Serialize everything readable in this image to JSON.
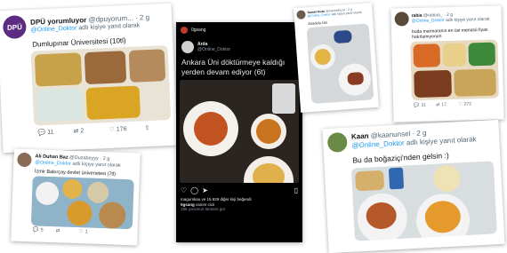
{
  "tweet_dpu": {
    "name": "DPÜ yorumluyor",
    "handle_time": "@dpuyorum... · 2 g",
    "reply_prefix": "@Online_Doktor",
    "reply_suffix": "adlı kişiye yanıt olarak",
    "avatar_text": "DPÜ",
    "text": "Dumlupınar Üniversitesi (10tl)",
    "replies": "11",
    "retweets": "2",
    "likes": "176"
  },
  "tweet_ali": {
    "name": "Ali Duhan Baz",
    "handle": "@Duzabeyyy · 2 g",
    "reply_prefix": "@Online_Doktor",
    "reply_suffix": "adlı kişiye yanıt olarak",
    "text": "İzmir Bakırçay devlet üniversitesi (7tl)",
    "replies": "5",
    "retweets": "",
    "likes": "1"
  },
  "insta": {
    "username": "0gsang",
    "post_name": "Arda",
    "post_handle": "@Online_Doktor",
    "post_text": "Ankara Üni döktürmeye kaldığı yerden devam ediyor (6t)",
    "likes_text": "magurskau ve 15.929 diğer kişi beğendi",
    "caption_user": "0gsang",
    "caption_text": "canım cicii",
    "comments": "186 yorumun tümünü gör",
    "footer_user": "0gsang"
  },
  "tweet_samet": {
    "name": "Samet Kuzu",
    "handle": "@SametKuzu · 2 g",
    "reply_prefix": "@Online_Doktor",
    "reply_suffix": "adlı kişiye yanıt olarak",
    "text": "Anadolu Üni"
  },
  "tweet_rabia": {
    "name": "rabia",
    "handle": "@rabiaa_ · 2 g",
    "reply_prefix": "@Online_Doktor",
    "reply_suffix": "adlı kişiye yanıt olarak",
    "text_line1": "buda marmaranın en üst menüsü fiyatı",
    "text_line2": "hatırlamıyorum",
    "replies": "31",
    "retweets": "17",
    "likes": "272"
  },
  "tweet_kaan": {
    "name": "Kaan",
    "handle_time": "@kaanunsel · 2 g",
    "reply_prefix": "@Online_Doktor",
    "reply_suffix": "adlı kişiye yanıt olarak",
    "text": "Bu da boğaziçi'nden gelsin :)"
  },
  "colors": {
    "blue": "#1d9bf0",
    "muted": "#536471",
    "tray_beige": "#e6dccb",
    "tray_blue": "#8fb3c9"
  }
}
